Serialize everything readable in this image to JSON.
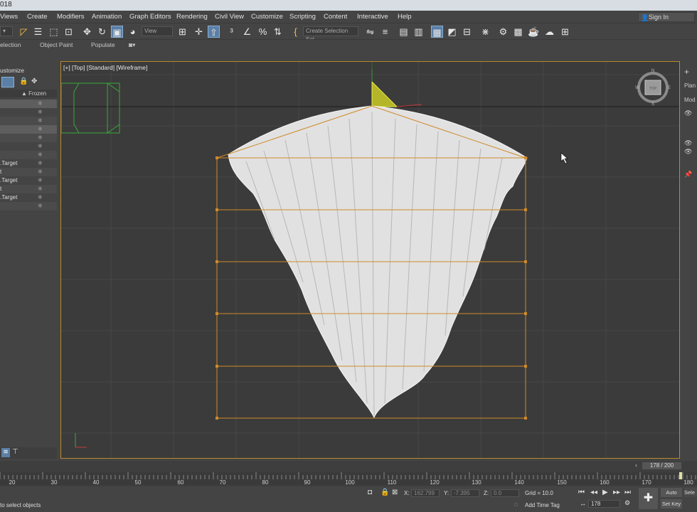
{
  "window": {
    "title_fragment": "018"
  },
  "menu": [
    "Views",
    "Create",
    "Modifiers",
    "Animation",
    "Graph Editors",
    "Rendering",
    "Civil View",
    "Customize",
    "Scripting",
    "Content",
    "Interactive",
    "Help"
  ],
  "signin": "Sign In",
  "toolbar": {
    "reference_coord": "View",
    "selection_set_placeholder": "Create Selection Set"
  },
  "ribbon": [
    "election",
    "Object Paint",
    "Populate"
  ],
  "scene_explorer": {
    "header": "ustomize",
    "frozen_col": "▲ Frozen",
    "rows": [
      ".Target",
      "t",
      ".Target",
      "t",
      ".Target"
    ]
  },
  "viewport": {
    "label": "[+] [Top] [Standard] [Wireframe]",
    "viewcube": {
      "top": "TOP",
      "n": "N",
      "w": "W",
      "e": "E",
      "s": "S"
    }
  },
  "right_panel": {
    "item1": "Plan",
    "item2": "Mod"
  },
  "timeline": {
    "frame_counter": "178 / 200",
    "ticks": [
      "20",
      "30",
      "40",
      "50",
      "60",
      "70",
      "80",
      "90",
      "100",
      "110",
      "120",
      "130",
      "140",
      "150",
      "160",
      "170",
      "180"
    ],
    "current_frame": 178
  },
  "status": {
    "prompt": "to select objects",
    "x_label": "X:",
    "x_val": "162.799",
    "y_label": "Y:",
    "y_val": "-7.395",
    "z_label": "Z:",
    "z_val": "0.0",
    "grid": "Grid = 10.0",
    "add_time_tag": "Add Time Tag",
    "auto_key": "Auto Key",
    "set_key": "Set Key",
    "sel": "Sele",
    "frame_field": "178"
  },
  "colors": {
    "accent": "#5b7fa6",
    "selection_orange": "#d08a2a",
    "viewport_bg": "#3b3b3b",
    "grid": "#4a4a4a"
  }
}
